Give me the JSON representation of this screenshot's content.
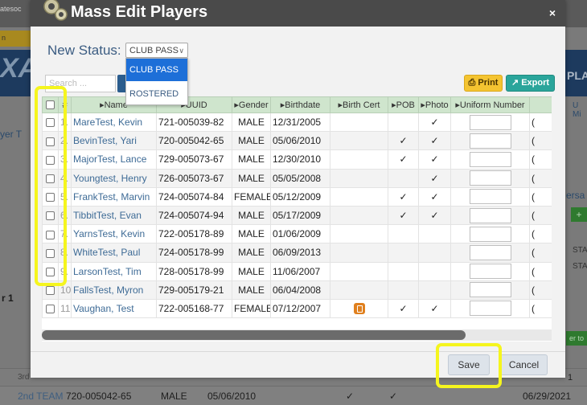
{
  "modal": {
    "title": "Mass Edit Players",
    "close_label": "×",
    "status_label": "New Status:",
    "status_value": "CLUB PASS",
    "status_options": [
      "CLUB PASS",
      "ROSTERED"
    ],
    "search_placeholder": "Search ...",
    "print_label": "Print",
    "export_label": "Export",
    "save_label": "Save",
    "cancel_label": "Cancel"
  },
  "table": {
    "columns": [
      "#",
      "▸Name",
      "▸UUID",
      "▸Gender",
      "▸Birthdate",
      "▸Birth Cert",
      "▸POB",
      "▸Photo",
      "▸Uniform Number"
    ],
    "rows": [
      {
        "num": "1.",
        "name": "MareTest, Kevin",
        "uuid": "721-005039-82",
        "gender": "MALE",
        "birthdate": "12/31/2005",
        "cert": "",
        "pob": "",
        "photo": "✓",
        "trail": "("
      },
      {
        "num": "2.",
        "name": "BevinTest, Yari",
        "uuid": "720-005042-65",
        "gender": "MALE",
        "birthdate": "05/06/2010",
        "cert": "",
        "pob": "✓",
        "photo": "✓",
        "trail": "("
      },
      {
        "num": "3.",
        "name": "MajorTest, Lance",
        "uuid": "729-005073-67",
        "gender": "MALE",
        "birthdate": "12/30/2010",
        "cert": "",
        "pob": "✓",
        "photo": "✓",
        "trail": "("
      },
      {
        "num": "4.",
        "name": "Youngtest, Henry",
        "uuid": "726-005073-67",
        "gender": "MALE",
        "birthdate": "05/05/2008",
        "cert": "",
        "pob": "",
        "photo": "✓",
        "trail": "("
      },
      {
        "num": "5.",
        "name": "FrankTest, Marvin",
        "uuid": "724-005074-84",
        "gender": "FEMALE",
        "birthdate": "05/12/2009",
        "cert": "",
        "pob": "✓",
        "photo": "✓",
        "trail": "("
      },
      {
        "num": "6.",
        "name": "TibbitTest, Evan",
        "uuid": "724-005074-94",
        "gender": "MALE",
        "birthdate": "05/17/2009",
        "cert": "",
        "pob": "✓",
        "photo": "✓",
        "trail": "("
      },
      {
        "num": "7.",
        "name": "YarnsTest, Kevin",
        "uuid": "722-005178-89",
        "gender": "MALE",
        "birthdate": "01/06/2009",
        "cert": "",
        "pob": "",
        "photo": "",
        "trail": "("
      },
      {
        "num": "8.",
        "name": "WhiteTest, Paul",
        "uuid": "724-005178-99",
        "gender": "MALE",
        "birthdate": "06/09/2013",
        "cert": "",
        "pob": "",
        "photo": "",
        "trail": "("
      },
      {
        "num": "9.",
        "name": "LarsonTest, Tim",
        "uuid": "728-005178-99",
        "gender": "MALE",
        "birthdate": "11/06/2007",
        "cert": "",
        "pob": "",
        "photo": "",
        "trail": "("
      },
      {
        "num": "10.",
        "name": "FallsTest, Myron",
        "uuid": "729-005179-21",
        "gender": "MALE",
        "birthdate": "06/04/2008",
        "cert": "",
        "pob": "",
        "photo": "",
        "trail": "("
      },
      {
        "num": "11.",
        "name": "Vaughan, Test",
        "uuid": "722-005168-77",
        "gender": "FEMALE",
        "birthdate": "07/12/2007",
        "cert": "icon",
        "pob": "✓",
        "photo": "✓",
        "trail": "("
      }
    ]
  },
  "background": {
    "top_text": "atesoc",
    "orange_text": "n",
    "banner_left": "XA",
    "banner_right": "PLA",
    "left_label": "yer T",
    "right_label": "ersa",
    "right_um": "U Mi",
    "right_plus": "+",
    "right_sta1": "STA",
    "right_sta2": "STA",
    "left_r1": "r 1",
    "right_er": "er to",
    "row1_a": "3rd",
    "row1_b": "1",
    "row2": {
      "team": "2nd TEAM",
      "uuid": "720-005042-65",
      "gender": "MALE",
      "birthdate": "05/06/2010",
      "check1": "✓",
      "check2": "✓",
      "date": "06/29/2021"
    }
  },
  "colors": {
    "header_bg": "#4a4a4a",
    "table_header_bg": "#cfe5cd",
    "name_link": "#3e6b96",
    "dropdown_selected": "#1d6fd8",
    "print_button": "#f4c431",
    "export_button": "#2aa59b",
    "highlight": "#f5f51e"
  }
}
